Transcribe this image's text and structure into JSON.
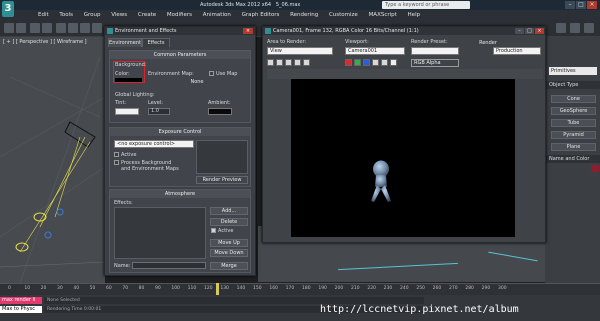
{
  "app": {
    "window_title": "Autodesk 3ds Max 2012 x64",
    "file_name": "5_06.max",
    "search_placeholder": "Type a keyword or phrase",
    "minimize": "–",
    "maximize": "□",
    "close": "×",
    "logo_text": "3"
  },
  "menu": [
    "Edit",
    "Tools",
    "Group",
    "Views",
    "Create",
    "Modifiers",
    "Animation",
    "Graph Editors",
    "Rendering",
    "Customize",
    "MAXScript",
    "Help"
  ],
  "viewport": {
    "label": "[ + ] [ Perspective ] [ Wireframe ]"
  },
  "env_dialog": {
    "title": "Environment and Effects",
    "tabs": [
      "Environment",
      "Effects"
    ],
    "common": {
      "header": "Common Parameters",
      "background_label": "Background:",
      "color_label": "Color:",
      "env_map_label": "Environment Map:",
      "use_map_label": "Use Map",
      "map_value": "None",
      "global_lighting_label": "Global Lighting:",
      "tint_label": "Tint:",
      "level_label": "Level:",
      "level_value": "1.0",
      "ambient_label": "Ambient:"
    },
    "exposure": {
      "header": "Exposure Control",
      "dropdown_value": "<no exposure control>",
      "active_label": "Active",
      "process_bg_label": "Process Background and Environment Maps",
      "render_preview_label": "Render Preview"
    },
    "atmosphere": {
      "header": "Atmosphere",
      "effects_label": "Effects:",
      "add_label": "Add...",
      "delete_label": "Delete",
      "active_label": "Active",
      "move_up_label": "Move Up",
      "move_down_label": "Move Down",
      "name_label": "Name:",
      "merge_label": "Merge"
    }
  },
  "render_window": {
    "title": "Camera001, Frame 132, RGBA Color 16 Bits/Channel (1:1)",
    "area_label": "Area to Render:",
    "area_value": "View",
    "viewport_label": "Viewport:",
    "viewport_value": "Camera001",
    "preset_label": "Render Preset:",
    "preset_value": "",
    "render_label": "Render",
    "mode_value": "Production",
    "channel_value": "RGB Alpha",
    "colors": {
      "red": "#d92b2b",
      "green": "#2bb24c",
      "blue": "#2b5cd9",
      "canvas": "#000000"
    }
  },
  "command_panel": {
    "dropdown_value": "Primitives",
    "object_type_header": "Object Type",
    "buttons": [
      "Cone",
      "GeoSphere",
      "Tube",
      "Pyramid",
      "Plane"
    ],
    "name_color_header": "Name and Color",
    "swatch_color": "#8c1f2f"
  },
  "timeline": {
    "ticks": [
      "0",
      "10",
      "20",
      "30",
      "40",
      "50",
      "60",
      "70",
      "80",
      "90",
      "100",
      "110",
      "120",
      "130",
      "140",
      "150",
      "160",
      "170",
      "180",
      "190",
      "200",
      "210",
      "220",
      "230",
      "240",
      "250",
      "260",
      "270",
      "280",
      "290",
      "300"
    ]
  },
  "status": {
    "maxscript_top": "max render li",
    "maxscript_bottom": "Max to Physc",
    "selection_text": "None Selected",
    "render_time_text": "Rendering Time 0:00:01",
    "watermark": "http://lccnetvip.pixnet.net/album"
  }
}
